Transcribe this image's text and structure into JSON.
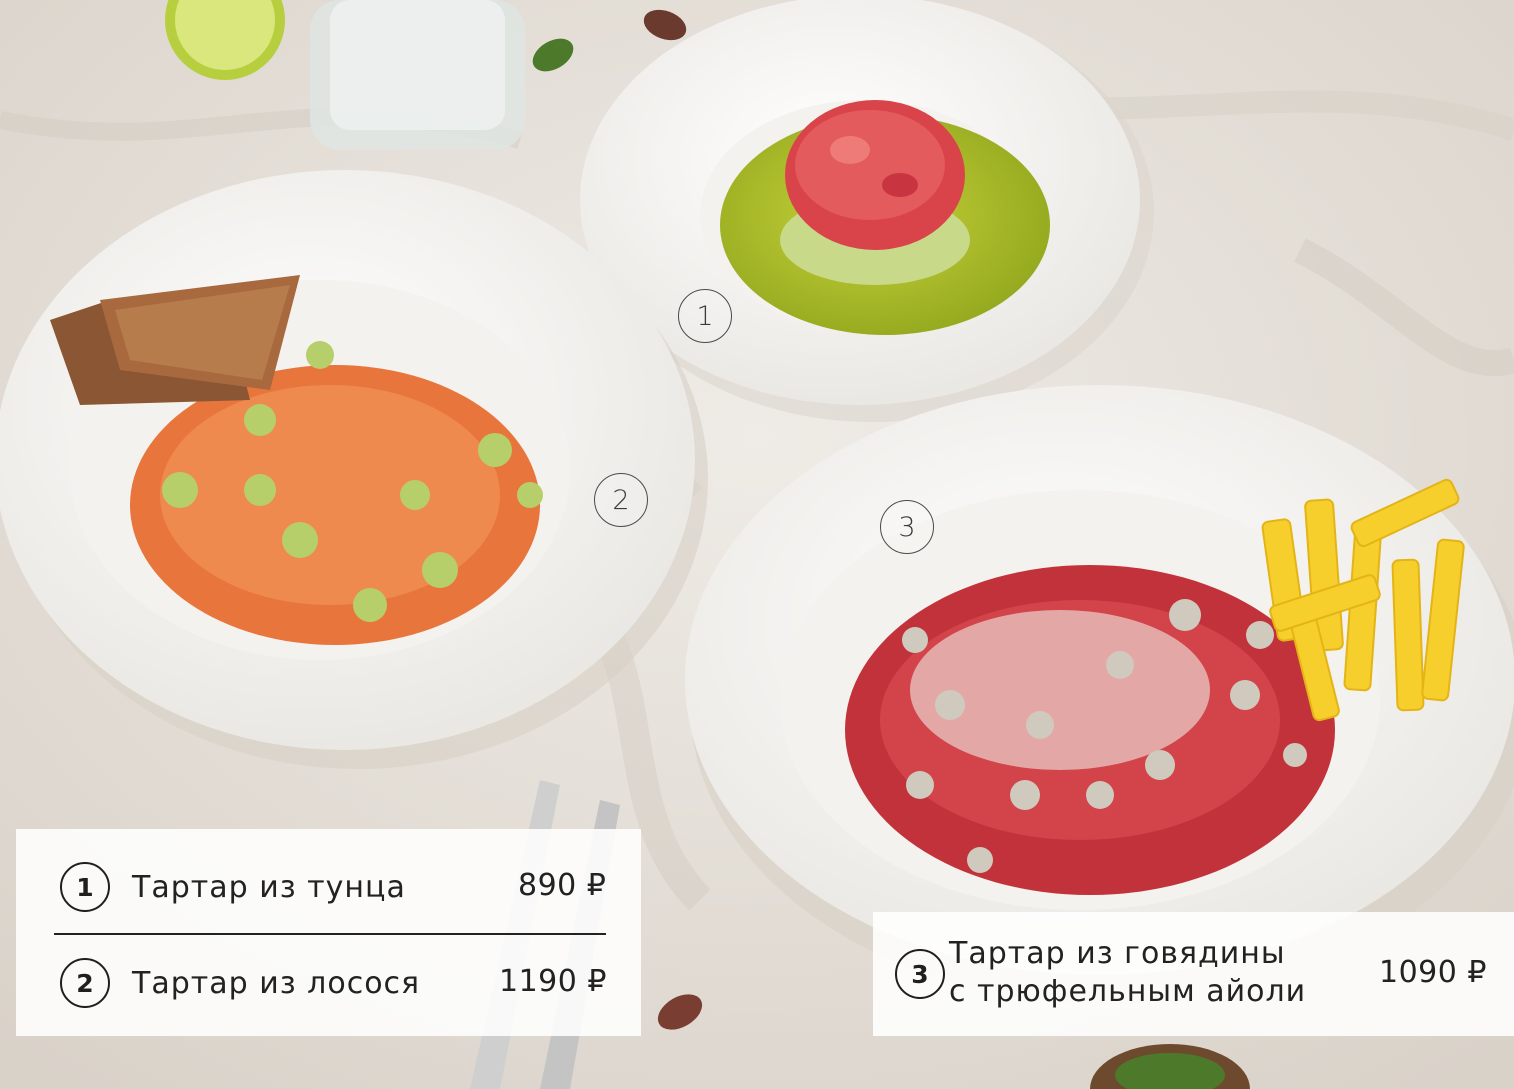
{
  "markers": {
    "tuna": "1",
    "salmon": "2",
    "beef": "3"
  },
  "menu": {
    "items": [
      {
        "number": "1",
        "name": "Тартар из тунца",
        "price": "890 ₽"
      },
      {
        "number": "2",
        "name": "Тартар из лосося",
        "price": "1190 ₽"
      },
      {
        "number": "3",
        "name_line1": "Тартар из говядины",
        "name_line2": "с трюфельным айоли",
        "price": "1090 ₽"
      }
    ]
  },
  "colors": {
    "tablecloth": "#e9e4de",
    "plate": "#f7f6f3",
    "salmon": "#e8753c",
    "tuna": "#d9444a",
    "beef": "#c2323a",
    "sauce": "#a9bd27",
    "fries": "#f6cf2c",
    "bread": "#8a5634"
  }
}
